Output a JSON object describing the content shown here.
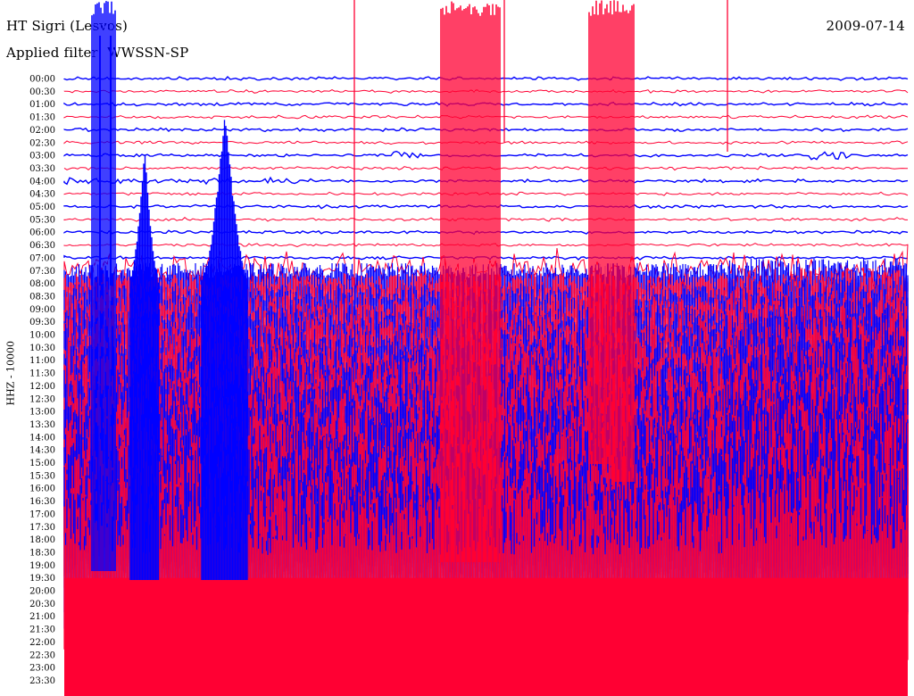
{
  "header": {
    "station": "HT Sigri (Lesvos)",
    "date": "2009-07-14",
    "filter": "Applied filter: WWSSN-SP"
  },
  "chart_data": {
    "type": "helicorder",
    "ylabel": "HHZ - 10000",
    "row_labels": [
      "00:00",
      "00:30",
      "01:00",
      "01:30",
      "02:00",
      "02:30",
      "03:00",
      "03:30",
      "04:00",
      "04:30",
      "05:00",
      "05:30",
      "06:00",
      "06:30",
      "07:00",
      "07:30",
      "08:00",
      "08:30",
      "09:00",
      "09:30",
      "10:00",
      "10:30",
      "11:00",
      "11:30",
      "12:00",
      "12:30",
      "13:00",
      "13:30",
      "14:00",
      "14:30",
      "15:00",
      "15:30",
      "16:00",
      "16:30",
      "17:00",
      "17:30",
      "18:00",
      "18:30",
      "19:00",
      "19:30",
      "20:00",
      "20:30",
      "21:00",
      "21:30",
      "22:00",
      "22:30",
      "23:00",
      "23:30"
    ],
    "trace_colors": [
      "#0000ff",
      "#ff0033"
    ],
    "rows_per_hour": 2,
    "quiet_until": "07:30",
    "saturated_from": "20:00"
  }
}
